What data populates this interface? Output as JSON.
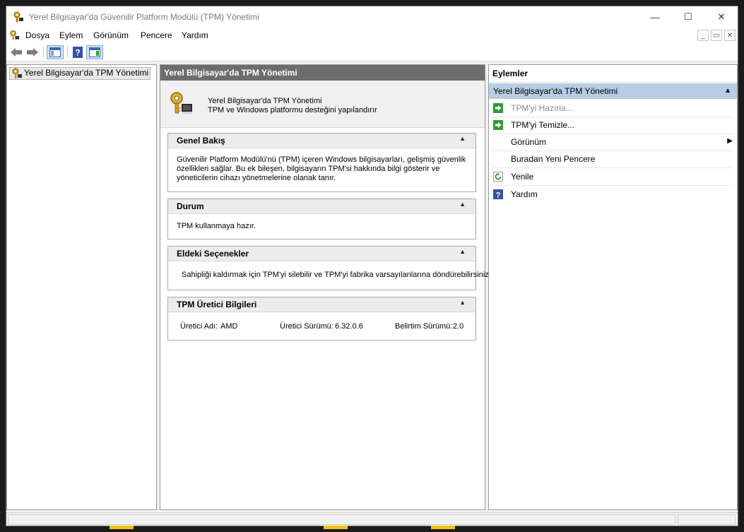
{
  "window": {
    "title": "Yerel Bilgisayar'da Güvenilir Platform Modülü (TPM) Yönetimi",
    "controls": {
      "minimize": "—",
      "maximize": "☐",
      "close": "✕"
    }
  },
  "menubar": {
    "items": [
      "Dosya",
      "Eylem",
      "Görünüm",
      "Pencere",
      "Yardım"
    ],
    "mdi": {
      "minimize": "_",
      "restore": "▭",
      "close": "✕"
    }
  },
  "toolbar": {
    "icons": [
      "back-arrow-icon",
      "forward-arrow-icon",
      "show-hide-console-tree-icon",
      "help-icon",
      "show-hide-action-pane-icon"
    ]
  },
  "tree": {
    "root_label": "Yerel Bilgisayar'da TPM Yönetimi"
  },
  "center": {
    "header": "Yerel Bilgisayar'da TPM Yönetimi",
    "intro_line1": "Yerel Bilgisayar'da TPM Yönetimi",
    "intro_line2": "TPM ve Windows platformu desteğini yapılandırır",
    "sections": {
      "overview": {
        "title": "Genel Bakış",
        "line1": "Güvenilir Platform Modülü'nü (TPM) içeren Windows bilgisayarları, gelişmiş güvenlik",
        "line2": "özellikleri sağlar. Bu ek bileşen, bilgisayarın TPM'si hakkında bilgi gösterir ve",
        "line3": "yöneticilerin cihazı yönetmelerine olanak tanır."
      },
      "status": {
        "title": "Durum",
        "text": "TPM kullanmaya hazır."
      },
      "options": {
        "title": "Eldeki Seçenekler",
        "text": "Sahipliği kaldırmak için TPM'yi silebilir ve TPM'yi fabrika varsayılanlarına döndürebilirsiniz."
      },
      "manufacturer": {
        "title": "TPM Üretici Bilgileri",
        "name_label": "Üretici Adı:",
        "name_value": "AMD",
        "version_label": "Üretici Sürümü:",
        "version_value": "6.32.0.6",
        "spec_label": "Belirtim Sürümü:",
        "spec_value": "2.0"
      }
    }
  },
  "actions": {
    "title": "Eylemler",
    "group": "Yerel Bilgisayar'da TPM Yönetimi",
    "items": [
      {
        "label": "TPM'yi Hazırla...",
        "icon": "green-arrow-icon",
        "enabled": false
      },
      {
        "label": "TPM'yi Temizle...",
        "icon": "green-arrow-icon",
        "enabled": true
      },
      {
        "label": "Görünüm",
        "icon": "",
        "enabled": true,
        "submenu": true
      },
      {
        "label": "Buradan Yeni Pencere",
        "icon": "",
        "enabled": true
      },
      {
        "label": "Yenile",
        "icon": "refresh-icon",
        "enabled": true
      },
      {
        "label": "Yardım",
        "icon": "help-icon",
        "enabled": true
      }
    ]
  },
  "colors": {
    "header_bg": "#6d6d6d",
    "action_group_bg": "#b8cce4",
    "disabled_text": "#8a8a8a",
    "accent_green": "#2e9e35",
    "help_blue": "#3553a8"
  }
}
